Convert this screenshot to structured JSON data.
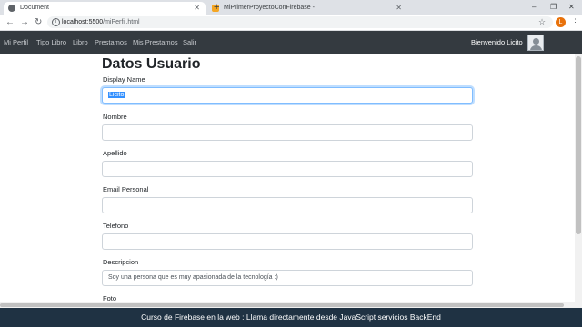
{
  "browser": {
    "tabs": [
      {
        "title": "Document",
        "active": true
      },
      {
        "title": "MiPrimerProyectoConFirebase -",
        "active": false
      }
    ],
    "new_tab": "+",
    "url_host": "localhost:5500",
    "url_path": "/miPerfil.html",
    "profile_initial": "L"
  },
  "navbar": {
    "items": [
      "Mi Perfil",
      "Tipo Libro",
      "Libro",
      "Prestamos",
      "Mis Prestamos",
      "Salir"
    ],
    "welcome": "Bienvenido Licito"
  },
  "page": {
    "title": "Datos Usuario",
    "fields": [
      {
        "label": "Display Name",
        "value": "Licito",
        "focused": true
      },
      {
        "label": "Nombre",
        "value": ""
      },
      {
        "label": "Apellido",
        "value": ""
      },
      {
        "label": "Email Personal",
        "value": ""
      },
      {
        "label": "Telefono",
        "value": ""
      },
      {
        "label": "Descripcion",
        "value": "Soy una persona que es muy apasionada de la tecnología :)"
      }
    ],
    "foto_label": "Foto"
  },
  "banner": "Curso de Firebase en la web : Llama directamente desde JavaScript servicios BackEnd",
  "colors": {
    "navbar_bg": "#343a40",
    "banner_bg": "#1f3243",
    "focus_border": "#80bdff",
    "selection": "#3390ff",
    "profile_badge": "#e8710a"
  }
}
